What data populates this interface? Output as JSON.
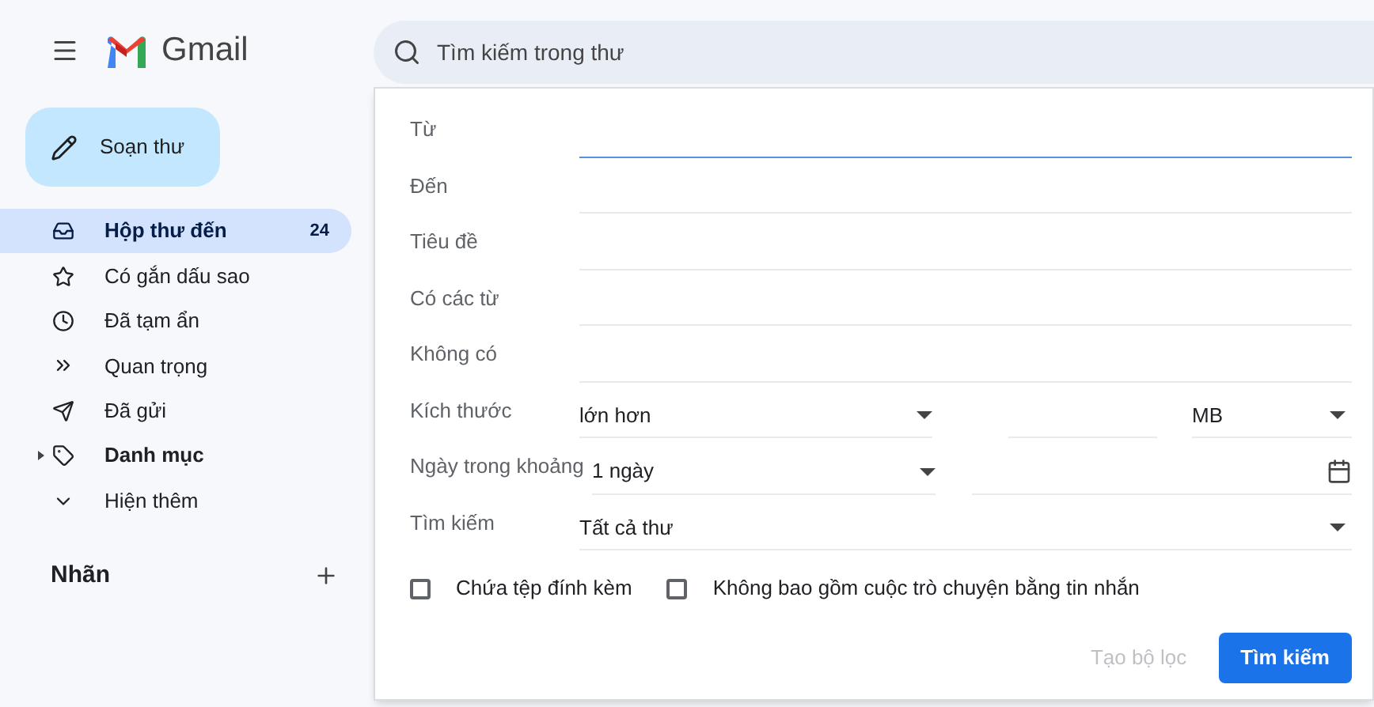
{
  "header": {
    "logo": "Gmail",
    "search": {
      "placeholder": "Tìm kiếm trong thư"
    }
  },
  "compose": {
    "label": "Soạn thư"
  },
  "nav": [
    {
      "label": "Hộp thư đến",
      "count": "24",
      "selected": true,
      "unread": true
    },
    {
      "label": "Có gắn dấu sao",
      "selected": false,
      "unread": false
    },
    {
      "label": "Đã tạm ẩn",
      "selected": false,
      "unread": false
    },
    {
      "label": "Quan trọng",
      "selected": false,
      "unread": false
    },
    {
      "label": "Đã gửi",
      "selected": false,
      "unread": false
    },
    {
      "label": "Danh mục",
      "selected": false,
      "unread": true
    },
    {
      "label": "Hiện thêm",
      "selected": false,
      "unread": false
    }
  ],
  "labels_section": {
    "title": "Nhãn"
  },
  "search_form": {
    "fields": [
      {
        "kind": "text",
        "label": "Từ",
        "focused": true
      },
      {
        "kind": "text",
        "label": "Đến",
        "focused": false
      },
      {
        "kind": "text",
        "label": "Tiêu đề",
        "focused": false
      },
      {
        "kind": "text",
        "label": "Có các từ",
        "focused": false
      },
      {
        "kind": "text",
        "label": "Không có",
        "focused": false
      },
      {
        "kind": "size",
        "label": "Kích thước",
        "comparator": "lớn hơn",
        "unit": "MB"
      },
      {
        "kind": "date",
        "label": "Ngày trong khoảng",
        "range": "1 ngày"
      },
      {
        "kind": "select",
        "label": "Tìm kiếm",
        "value": "Tất cả thư"
      }
    ],
    "checkboxes": [
      {
        "label": "Chứa tệp đính kèm",
        "checked": false
      },
      {
        "label": "Không bao gồm cuộc trò chuyện bằng tin nhắn",
        "checked": false
      }
    ],
    "buttons": [
      {
        "label": "Tạo bộ lọc",
        "kind": "text",
        "disabled": true
      },
      {
        "label": "Tìm kiếm",
        "kind": "primary",
        "disabled": false
      }
    ]
  }
}
